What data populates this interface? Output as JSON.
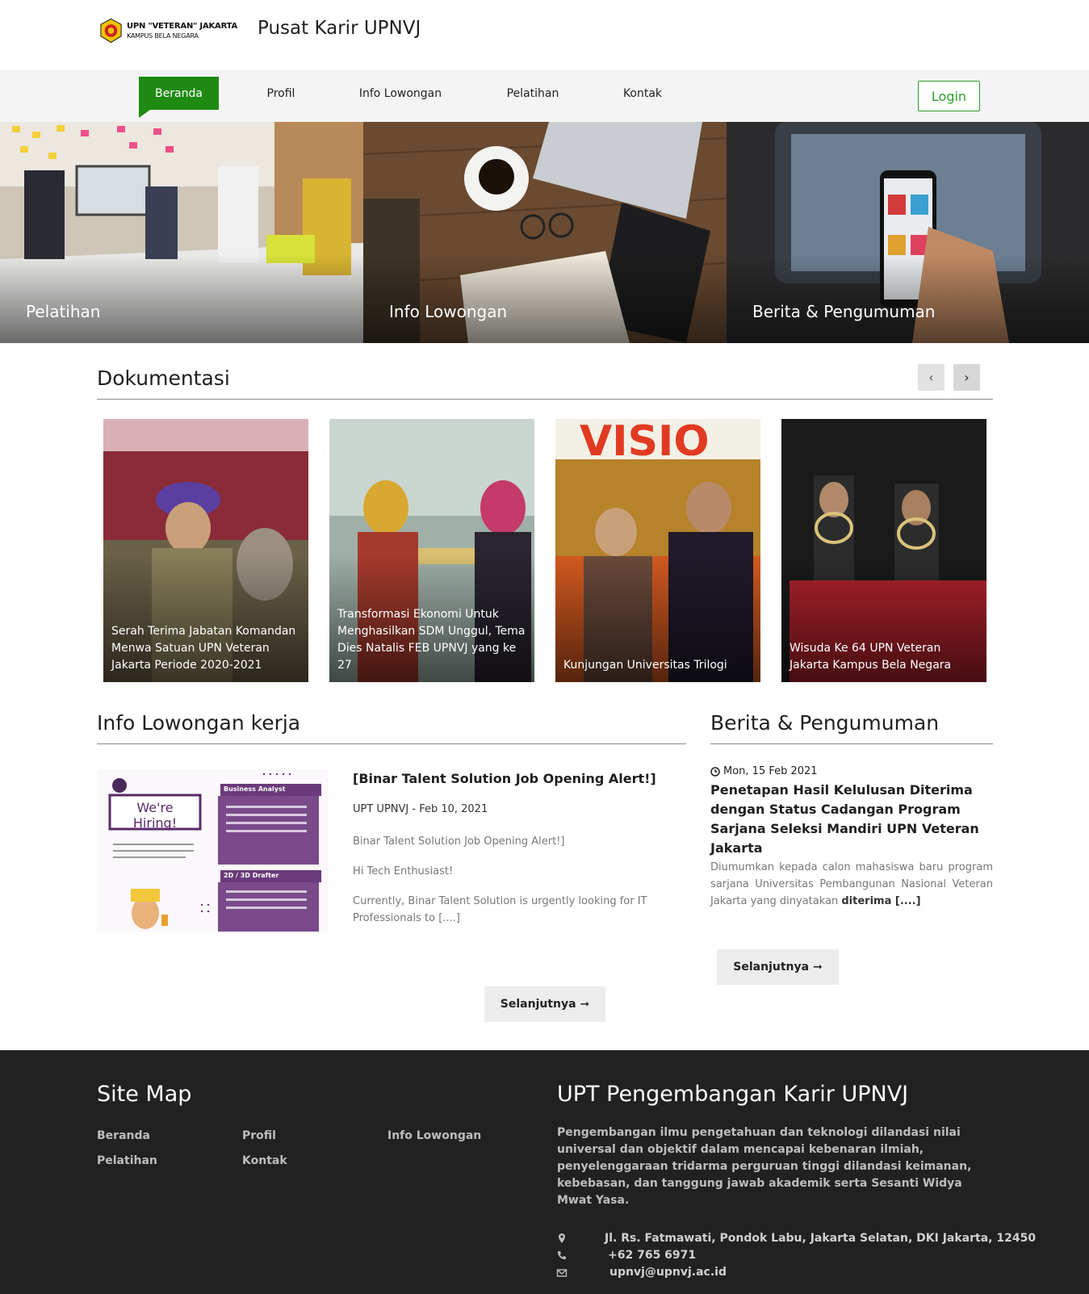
{
  "header": {
    "logo_line1": "UPN \"VETERAN\" JAKARTA",
    "logo_line2": "KAMPUS BELA NEGARA",
    "site_title": "Pusat Karir UPNVJ"
  },
  "nav": {
    "items": [
      {
        "label": "Beranda",
        "active": true
      },
      {
        "label": "Profil"
      },
      {
        "label": "Info Lowongan"
      },
      {
        "label": "Pelatihan"
      },
      {
        "label": "Kontak"
      }
    ],
    "login_label": "Login",
    "accent_color": "#1f8a12"
  },
  "banners": [
    {
      "label": "Pelatihan"
    },
    {
      "label": "Info Lowongan"
    },
    {
      "label": "Berita & Pengumuman"
    }
  ],
  "documentation": {
    "title": "Dokumentasi",
    "prev_icon": "chevron-left-icon",
    "next_icon": "chevron-right-icon",
    "cards": [
      {
        "caption": "Serah Terima Jabatan Komandan Menwa Satuan UPN Veteran Jakarta Periode 2020-2021"
      },
      {
        "caption": "Transformasi Ekonomi Untuk Menghasilkan SDM Unggul, Tema Dies Natalis FEB UPNVJ yang ke 27"
      },
      {
        "caption": "Kunjungan Universitas Trilogi"
      },
      {
        "caption": "Wisuda Ke 64 UPN Veteran Jakarta Kampus Bela Negara"
      }
    ]
  },
  "jobs": {
    "title": "Info Lowongan kerja",
    "thumb_heading": "We're Hiring!",
    "thumb_role1": "Business Analyst",
    "thumb_role2": "2D / 3D Drafter",
    "item_title": "[Binar Talent Solution Job Opening Alert!]",
    "item_meta": "UPT UPNVJ - Feb 10, 2021",
    "item_line1": "Binar Talent Solution Job Opening Alert!]",
    "item_line2": "Hi Tech Enthusiast!",
    "item_line3": "Currently, Binar Talent Solution is urgently looking for IT Professionals to [....]",
    "more_label": "Selanjutnya ➞"
  },
  "news": {
    "title": "Berita & Pengumuman",
    "date": "Mon, 15 Feb 2021",
    "item_title": "Penetapan Hasil Kelulusan Diterima dengan Status Cadangan Program Sarjana Seleksi Mandiri UPN Veteran Jakarta",
    "excerpt": "Diumumkan kepada calon mahasiswa baru program sarjana Universitas Pembangunan Nasional Veteran Jakarta yang dinyatakan",
    "excerpt_bold": "diterima [....]",
    "more_label": "Selanjutnya ➞"
  },
  "footer": {
    "sitemap_title": "Site Map",
    "links": [
      "Beranda",
      "Profil",
      "Info Lowongan",
      "Pelatihan",
      "Kontak"
    ],
    "about_title": "UPT Pengembangan Karir UPNVJ",
    "about_text": "Pengembangan ilmu pengetahuan dan teknologi dilandasi nilai universal dan objektif dalam mencapai kebenaran ilmiah, penyelenggaraan tridarma perguruan tinggi dilandasi keimanan, kebebasan, dan tanggung jawab akademik serta Sesanti Widya Mwat Yasa.",
    "address": "Jl. Rs. Fatmawati, Pondok Labu, Jakarta Selatan, DKI Jakarta, 12450",
    "phone": "+62 765 6971",
    "email": "upnvj@upnvj.ac.id",
    "background": "#212121"
  }
}
